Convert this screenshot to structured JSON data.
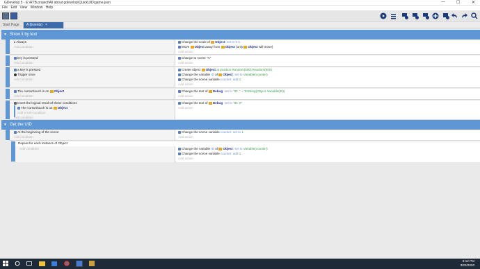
{
  "window": {
    "title": "GDevelop 5 - E:\\RTB project\\All about gdevelop\\QuickUID\\game.json",
    "minimize": "—",
    "maximize": "☐",
    "close": "✕"
  },
  "menu": [
    "File",
    "Edit",
    "View",
    "Window",
    "Help"
  ],
  "toolbar_icons": [
    "play-icon",
    "add-event-icon",
    "add-subevent-icon",
    "add-comment-icon",
    "add-group-icon",
    "add-other-icon",
    "delete-icon",
    "undo-icon",
    "redo-icon",
    "search-icon"
  ],
  "tabs": [
    {
      "label": "Start Page",
      "active": false
    },
    {
      "label": "A (Events)",
      "active": true,
      "close": "×"
    }
  ],
  "groups": [
    {
      "label": "Show it by text",
      "chevron": "▼"
    },
    {
      "label": "Get the UID",
      "chevron": "▼"
    }
  ],
  "events": {
    "e1": {
      "cond": [
        "Always"
      ],
      "add_cond": "Add condition",
      "acts": {
        "a1_pre": "Change the scale of",
        "a1_obj": "Object",
        "a1_post": ": set to 0.5",
        "a2_pre": "Move",
        "a2_obj": "Object",
        "a2_mid": "away from",
        "a2_obj2": "Object",
        "a2_mid2": "(only",
        "a2_obj3": "Object",
        "a2_post": "will move)"
      },
      "add_act": "Add action"
    },
    "e2": {
      "cond": "key is pressed",
      "add_cond": "Add condition",
      "act": "Change to scene \"A\"",
      "add_act": "Add action"
    },
    "e3": {
      "cond1": "a key is pressed",
      "cond2": "Trigger once",
      "add_cond": "Add condition",
      "a1_pre": "Create object",
      "a1_obj": "Object",
      "a1_post": "at position Random(500);Random(500)",
      "a2_pre": "Change the variable",
      "a2_var": "ID",
      "a2_mid": "of",
      "a2_obj": "Object",
      "a2_post": ": set to",
      "a2_val": "Variable(counter)",
      "a3_pre": "Change the scene variable",
      "a3_var": "counter",
      "a3_post": ": add",
      "a3_val": "1",
      "add_act": "Add action"
    },
    "e4": {
      "cond_pre": "The cursor/touch is on",
      "cond_obj": "Object",
      "add_cond": "Add condition",
      "a1_pre": "Change the text of",
      "a1_obj": "Debug",
      "a1_mid": ": set to",
      "a1_val": "\"ID: \" + ToString(Object.Variable(ID))",
      "add_act": "Add action"
    },
    "e5": {
      "cond1": "Invert the logical result of these conditions",
      "cond2_pre": "The cursor/touch is on",
      "cond2_obj": "Object",
      "add_sub": "Add a sub-condition",
      "add_cond": "Add condition",
      "a1_pre": "Change the text of",
      "a1_obj": "Debug",
      "a1_mid": ": set to",
      "a1_val": "\"ID: 0\"",
      "add_act": "Add action"
    },
    "e6": {
      "cond": "At the beginning of the scene",
      "add_cond": "Add condition",
      "a1_pre": "Change the scene variable",
      "a1_var": "counter",
      "a1_post": ": set to",
      "a1_val": "1",
      "add_act": "Add action"
    },
    "e7": {
      "header": "Repeat for each instance of Object:",
      "add_cond": "Add condition",
      "a1_pre": "Change the variable",
      "a1_var": "ID",
      "a1_mid": "of",
      "a1_obj": "Object",
      "a1_post": ": set to",
      "a1_val": "Variable(counter)",
      "a2_pre": "Change the scene variable",
      "a2_var": "counter",
      "a2_post": ": add",
      "a2_val": "1",
      "add_act": "Add action"
    }
  },
  "taskbar": {
    "time": "8:12 PM",
    "date": "3/22/2020"
  },
  "colors": {
    "group": "#5e96d6",
    "tab_active": "#3c6bab",
    "object": "#e6a72b",
    "value": "#3b9b4e",
    "keyword": "#6d8fd4"
  }
}
